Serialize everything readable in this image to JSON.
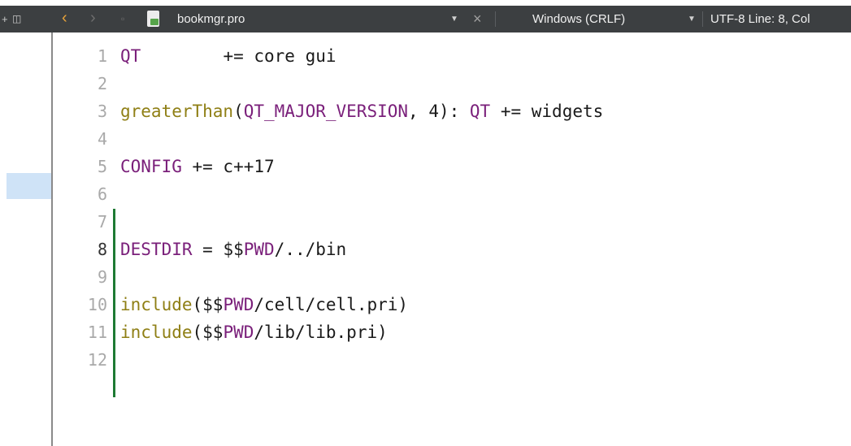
{
  "toolbar": {
    "plus_glyph": "+",
    "split_glyph": "◫",
    "back_glyph": "‹",
    "forward_glyph": "›",
    "lock_glyph": "▫",
    "file_name": "bookmgr.pro",
    "dropdown_glyph": "▼",
    "close_glyph": "×",
    "line_ending": "Windows (CRLF)",
    "encoding_status": "UTF-8 Line: 8, Col"
  },
  "colors": {
    "toolbar_bg": "#3c3f41",
    "keyword": "#7a1f7a",
    "function": "#8f7f15",
    "change_bar": "#1e7a33",
    "back_arrow": "#e8a33a"
  },
  "editor": {
    "current_line": 8,
    "lines": [
      {
        "no": "1",
        "segments": [
          {
            "t": "QT",
            "c": "kw"
          },
          {
            "t": "        += core gui",
            "c": ""
          }
        ]
      },
      {
        "no": "2",
        "segments": []
      },
      {
        "no": "3",
        "segments": [
          {
            "t": "greaterThan",
            "c": "fn"
          },
          {
            "t": "(",
            "c": ""
          },
          {
            "t": "QT_MAJOR_VERSION",
            "c": "kw"
          },
          {
            "t": ", 4): ",
            "c": ""
          },
          {
            "t": "QT",
            "c": "kw"
          },
          {
            "t": " += widgets",
            "c": ""
          }
        ]
      },
      {
        "no": "4",
        "segments": []
      },
      {
        "no": "5",
        "segments": [
          {
            "t": "CONFIG",
            "c": "kw"
          },
          {
            "t": " += c++17",
            "c": ""
          }
        ]
      },
      {
        "no": "6",
        "segments": []
      },
      {
        "no": "7",
        "segments": []
      },
      {
        "no": "8",
        "segments": [
          {
            "t": "DESTDIR",
            "c": "kw"
          },
          {
            "t": " = $$",
            "c": ""
          },
          {
            "t": "PWD",
            "c": "kw"
          },
          {
            "t": "/../bin",
            "c": ""
          }
        ]
      },
      {
        "no": "9",
        "segments": []
      },
      {
        "no": "10",
        "segments": [
          {
            "t": "include",
            "c": "fn"
          },
          {
            "t": "($$",
            "c": ""
          },
          {
            "t": "PWD",
            "c": "kw"
          },
          {
            "t": "/cell/cell.pri)",
            "c": ""
          }
        ]
      },
      {
        "no": "11",
        "segments": [
          {
            "t": "include",
            "c": "fn"
          },
          {
            "t": "($$",
            "c": ""
          },
          {
            "t": "PWD",
            "c": "kw"
          },
          {
            "t": "/lib/lib.pri)",
            "c": ""
          }
        ]
      },
      {
        "no": "12",
        "segments": []
      }
    ]
  }
}
